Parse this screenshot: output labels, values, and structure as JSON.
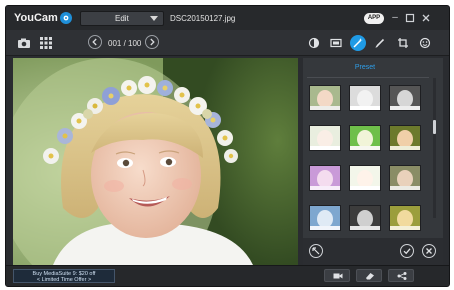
{
  "app": {
    "name": "YouCam",
    "badge_icon": "youcam-logo-icon"
  },
  "mode_dropdown": {
    "value": "Edit"
  },
  "file": {
    "name": "DSC20150127.jpg"
  },
  "titlebar": {
    "app_badge": "APP",
    "controls": [
      "minimize-icon",
      "maximize-icon",
      "close-icon"
    ]
  },
  "toolbar": {
    "left_icons": [
      "camera-icon",
      "grid-icon"
    ],
    "pager": {
      "label": "001 / 100"
    },
    "tools": [
      "brightness-icon",
      "frame-icon",
      "magic-wand-icon",
      "brush-icon",
      "crop-icon",
      "face-icon"
    ],
    "active_tool": "magic-wand-icon"
  },
  "panel": {
    "title": "Preset",
    "presets_visible": 12,
    "footer_icons": [
      "reset-icon",
      "apply-check-icon",
      "cancel-x-icon"
    ]
  },
  "status": {
    "promo_line1": "Buy  MediaSuite 9: $20 off",
    "promo_line2": "< Limited Time Offer >",
    "buttons": [
      "video-icon",
      "eraser-icon",
      "share-icon"
    ]
  },
  "colors": {
    "accent": "#1f9be6",
    "window_bg": "#2a2c30",
    "panel_bg": "#35383c"
  }
}
